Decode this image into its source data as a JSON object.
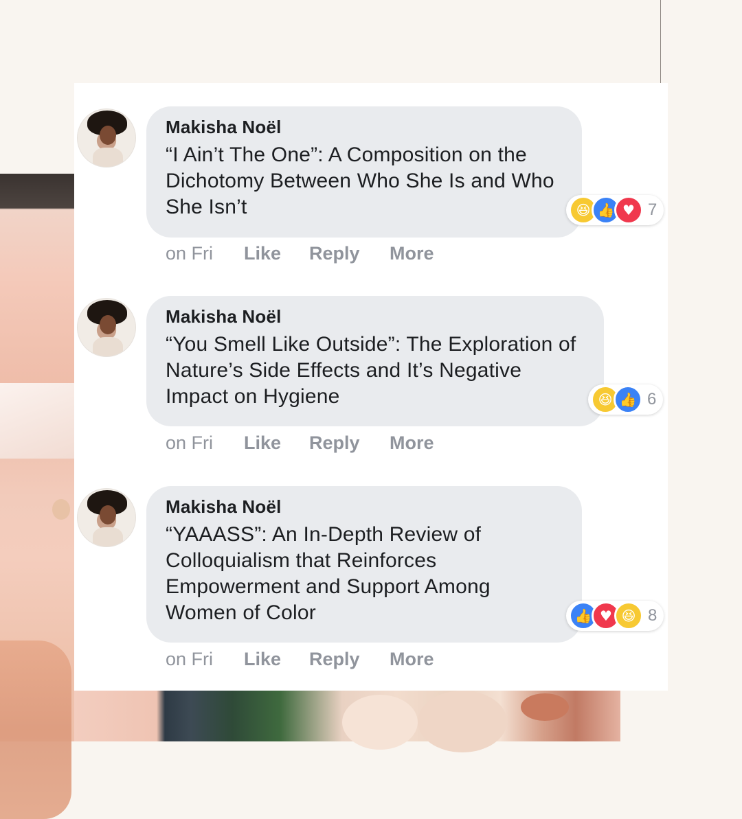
{
  "comments": [
    {
      "author": "Makisha Noël",
      "text": "“I Ain’t The One”: A Composition on the Dichotomy Between Who She Is and Who She Isn’t",
      "time": "on Fri",
      "actions": [
        "Like",
        "Reply",
        "More"
      ],
      "reactions": [
        "haha-icon",
        "like-icon",
        "love-icon"
      ],
      "reaction_count": "7"
    },
    {
      "author": "Makisha Noël",
      "text": "“You Smell Like Outside”: The Exploration of Nature’s Side Effects and It’s Negative Impact on Hygiene",
      "time": "on Fri",
      "actions": [
        "Like",
        "Reply",
        "More"
      ],
      "reactions": [
        "haha-icon",
        "like-icon"
      ],
      "reaction_count": "6"
    },
    {
      "author": "Makisha Noël",
      "text": "“YAAASS”: An In-Depth Review of Colloquialism that Reinforces Empowerment and Support Among Women of Color",
      "time": "on Fri",
      "actions": [
        "Like",
        "Reply",
        "More"
      ],
      "reactions": [
        "like-icon",
        "love-icon",
        "haha-icon"
      ],
      "reaction_count": "8"
    }
  ],
  "colors": {
    "bubble": "#e9ebee",
    "meta_text": "#90949c",
    "like": "#3b82f6",
    "love": "#f0384d",
    "haha": "#f7c932"
  }
}
